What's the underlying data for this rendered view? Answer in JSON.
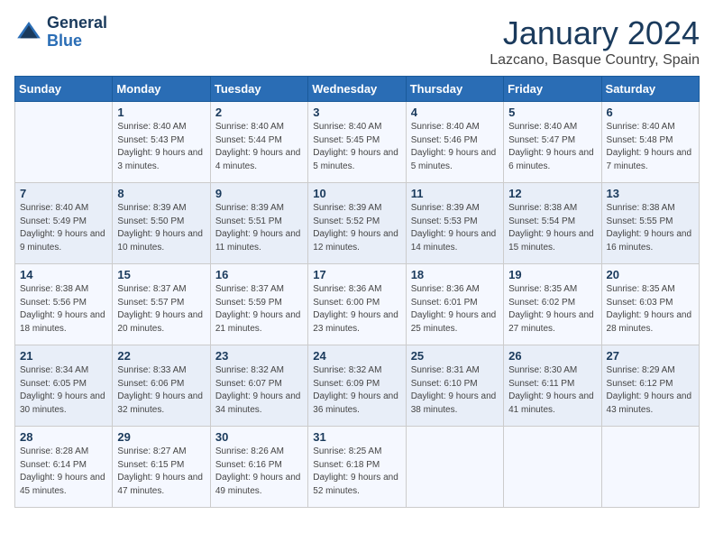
{
  "header": {
    "logo_line1": "General",
    "logo_line2": "Blue",
    "month": "January 2024",
    "location": "Lazcano, Basque Country, Spain"
  },
  "weekdays": [
    "Sunday",
    "Monday",
    "Tuesday",
    "Wednesday",
    "Thursday",
    "Friday",
    "Saturday"
  ],
  "weeks": [
    [
      {
        "day": "",
        "sunrise": "",
        "sunset": "",
        "daylight": ""
      },
      {
        "day": "1",
        "sunrise": "Sunrise: 8:40 AM",
        "sunset": "Sunset: 5:43 PM",
        "daylight": "Daylight: 9 hours and 3 minutes."
      },
      {
        "day": "2",
        "sunrise": "Sunrise: 8:40 AM",
        "sunset": "Sunset: 5:44 PM",
        "daylight": "Daylight: 9 hours and 4 minutes."
      },
      {
        "day": "3",
        "sunrise": "Sunrise: 8:40 AM",
        "sunset": "Sunset: 5:45 PM",
        "daylight": "Daylight: 9 hours and 5 minutes."
      },
      {
        "day": "4",
        "sunrise": "Sunrise: 8:40 AM",
        "sunset": "Sunset: 5:46 PM",
        "daylight": "Daylight: 9 hours and 5 minutes."
      },
      {
        "day": "5",
        "sunrise": "Sunrise: 8:40 AM",
        "sunset": "Sunset: 5:47 PM",
        "daylight": "Daylight: 9 hours and 6 minutes."
      },
      {
        "day": "6",
        "sunrise": "Sunrise: 8:40 AM",
        "sunset": "Sunset: 5:48 PM",
        "daylight": "Daylight: 9 hours and 7 minutes."
      }
    ],
    [
      {
        "day": "7",
        "sunrise": "Sunrise: 8:40 AM",
        "sunset": "Sunset: 5:49 PM",
        "daylight": "Daylight: 9 hours and 9 minutes."
      },
      {
        "day": "8",
        "sunrise": "Sunrise: 8:39 AM",
        "sunset": "Sunset: 5:50 PM",
        "daylight": "Daylight: 9 hours and 10 minutes."
      },
      {
        "day": "9",
        "sunrise": "Sunrise: 8:39 AM",
        "sunset": "Sunset: 5:51 PM",
        "daylight": "Daylight: 9 hours and 11 minutes."
      },
      {
        "day": "10",
        "sunrise": "Sunrise: 8:39 AM",
        "sunset": "Sunset: 5:52 PM",
        "daylight": "Daylight: 9 hours and 12 minutes."
      },
      {
        "day": "11",
        "sunrise": "Sunrise: 8:39 AM",
        "sunset": "Sunset: 5:53 PM",
        "daylight": "Daylight: 9 hours and 14 minutes."
      },
      {
        "day": "12",
        "sunrise": "Sunrise: 8:38 AM",
        "sunset": "Sunset: 5:54 PM",
        "daylight": "Daylight: 9 hours and 15 minutes."
      },
      {
        "day": "13",
        "sunrise": "Sunrise: 8:38 AM",
        "sunset": "Sunset: 5:55 PM",
        "daylight": "Daylight: 9 hours and 16 minutes."
      }
    ],
    [
      {
        "day": "14",
        "sunrise": "Sunrise: 8:38 AM",
        "sunset": "Sunset: 5:56 PM",
        "daylight": "Daylight: 9 hours and 18 minutes."
      },
      {
        "day": "15",
        "sunrise": "Sunrise: 8:37 AM",
        "sunset": "Sunset: 5:57 PM",
        "daylight": "Daylight: 9 hours and 20 minutes."
      },
      {
        "day": "16",
        "sunrise": "Sunrise: 8:37 AM",
        "sunset": "Sunset: 5:59 PM",
        "daylight": "Daylight: 9 hours and 21 minutes."
      },
      {
        "day": "17",
        "sunrise": "Sunrise: 8:36 AM",
        "sunset": "Sunset: 6:00 PM",
        "daylight": "Daylight: 9 hours and 23 minutes."
      },
      {
        "day": "18",
        "sunrise": "Sunrise: 8:36 AM",
        "sunset": "Sunset: 6:01 PM",
        "daylight": "Daylight: 9 hours and 25 minutes."
      },
      {
        "day": "19",
        "sunrise": "Sunrise: 8:35 AM",
        "sunset": "Sunset: 6:02 PM",
        "daylight": "Daylight: 9 hours and 27 minutes."
      },
      {
        "day": "20",
        "sunrise": "Sunrise: 8:35 AM",
        "sunset": "Sunset: 6:03 PM",
        "daylight": "Daylight: 9 hours and 28 minutes."
      }
    ],
    [
      {
        "day": "21",
        "sunrise": "Sunrise: 8:34 AM",
        "sunset": "Sunset: 6:05 PM",
        "daylight": "Daylight: 9 hours and 30 minutes."
      },
      {
        "day": "22",
        "sunrise": "Sunrise: 8:33 AM",
        "sunset": "Sunset: 6:06 PM",
        "daylight": "Daylight: 9 hours and 32 minutes."
      },
      {
        "day": "23",
        "sunrise": "Sunrise: 8:32 AM",
        "sunset": "Sunset: 6:07 PM",
        "daylight": "Daylight: 9 hours and 34 minutes."
      },
      {
        "day": "24",
        "sunrise": "Sunrise: 8:32 AM",
        "sunset": "Sunset: 6:09 PM",
        "daylight": "Daylight: 9 hours and 36 minutes."
      },
      {
        "day": "25",
        "sunrise": "Sunrise: 8:31 AM",
        "sunset": "Sunset: 6:10 PM",
        "daylight": "Daylight: 9 hours and 38 minutes."
      },
      {
        "day": "26",
        "sunrise": "Sunrise: 8:30 AM",
        "sunset": "Sunset: 6:11 PM",
        "daylight": "Daylight: 9 hours and 41 minutes."
      },
      {
        "day": "27",
        "sunrise": "Sunrise: 8:29 AM",
        "sunset": "Sunset: 6:12 PM",
        "daylight": "Daylight: 9 hours and 43 minutes."
      }
    ],
    [
      {
        "day": "28",
        "sunrise": "Sunrise: 8:28 AM",
        "sunset": "Sunset: 6:14 PM",
        "daylight": "Daylight: 9 hours and 45 minutes."
      },
      {
        "day": "29",
        "sunrise": "Sunrise: 8:27 AM",
        "sunset": "Sunset: 6:15 PM",
        "daylight": "Daylight: 9 hours and 47 minutes."
      },
      {
        "day": "30",
        "sunrise": "Sunrise: 8:26 AM",
        "sunset": "Sunset: 6:16 PM",
        "daylight": "Daylight: 9 hours and 49 minutes."
      },
      {
        "day": "31",
        "sunrise": "Sunrise: 8:25 AM",
        "sunset": "Sunset: 6:18 PM",
        "daylight": "Daylight: 9 hours and 52 minutes."
      },
      {
        "day": "",
        "sunrise": "",
        "sunset": "",
        "daylight": ""
      },
      {
        "day": "",
        "sunrise": "",
        "sunset": "",
        "daylight": ""
      },
      {
        "day": "",
        "sunrise": "",
        "sunset": "",
        "daylight": ""
      }
    ]
  ]
}
